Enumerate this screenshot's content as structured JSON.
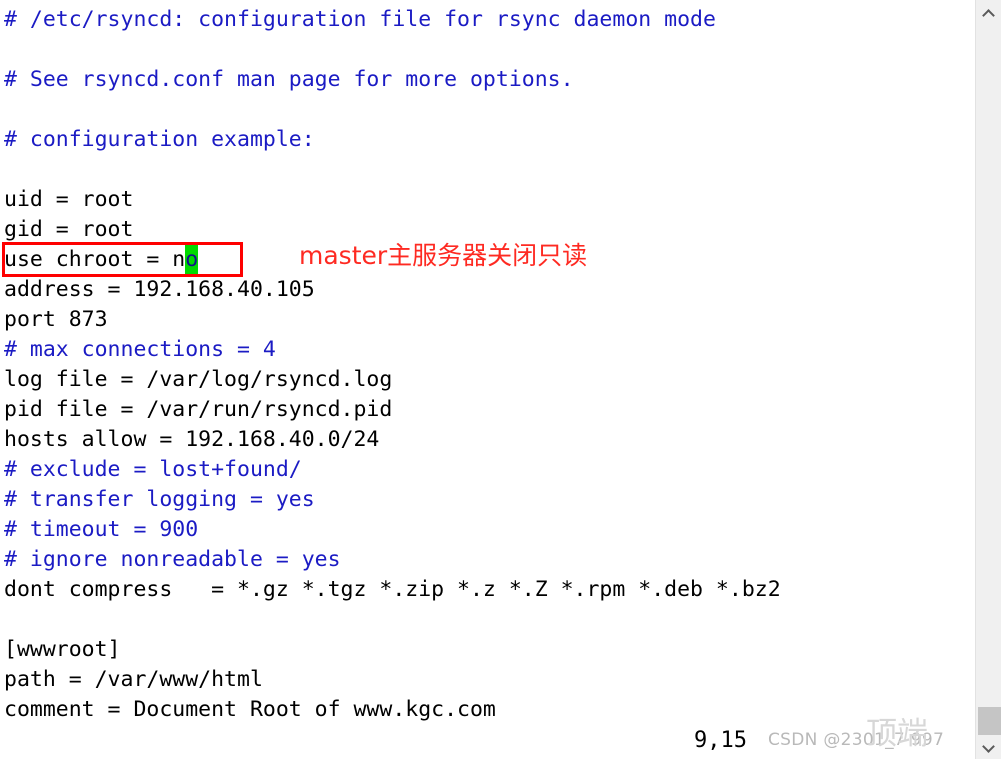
{
  "editor": {
    "file_type": "rsyncd-config",
    "lines": [
      {
        "text": "# /etc/rsyncd: configuration file for rsync daemon mode",
        "kind": "comment"
      },
      {
        "text": "",
        "kind": "blank"
      },
      {
        "text": "# See rsyncd.conf man page for more options.",
        "kind": "comment"
      },
      {
        "text": "",
        "kind": "blank"
      },
      {
        "text": "# configuration example:",
        "kind": "comment"
      },
      {
        "text": "",
        "kind": "blank"
      },
      {
        "text": "uid = root",
        "kind": "code"
      },
      {
        "text": "gid = root",
        "kind": "code"
      },
      {
        "text": "use chroot = no",
        "kind": "code",
        "cursor_col": 14
      },
      {
        "text": "address = 192.168.40.105",
        "kind": "code"
      },
      {
        "text": "port 873",
        "kind": "code"
      },
      {
        "text": "# max connections = 4",
        "kind": "comment"
      },
      {
        "text": "log file = /var/log/rsyncd.log",
        "kind": "code"
      },
      {
        "text": "pid file = /var/run/rsyncd.pid",
        "kind": "code"
      },
      {
        "text": "hosts allow = 192.168.40.0/24",
        "kind": "code"
      },
      {
        "text": "# exclude = lost+found/",
        "kind": "comment"
      },
      {
        "text": "# transfer logging = yes",
        "kind": "comment"
      },
      {
        "text": "# timeout = 900",
        "kind": "comment"
      },
      {
        "text": "# ignore nonreadable = yes",
        "kind": "comment"
      },
      {
        "text": "dont compress   = *.gz *.tgz *.zip *.z *.Z *.rpm *.deb *.bz2",
        "kind": "code"
      },
      {
        "text": "",
        "kind": "blank"
      },
      {
        "text": "[wwwroot]",
        "kind": "code"
      },
      {
        "text": "path = /var/www/html",
        "kind": "code"
      },
      {
        "text": "comment = Document Root of www.kgc.com",
        "kind": "code"
      }
    ],
    "colors": {
      "comment": "#1b1bc4",
      "code": "#000000",
      "background": "#ffffff",
      "cursor_background": "#00d900",
      "cursor_foreground": "#10108c"
    }
  },
  "annotation": {
    "box_label": "use chroot = no",
    "note_text": "master主服务器关闭只读",
    "color": "#fe0000",
    "note_color": "#fe2a22"
  },
  "status": {
    "cursor_position": "9,15"
  },
  "watermark": {
    "small_text": "CSDN @2301_7    997",
    "big_text": "顶端"
  },
  "scrollbar": {
    "up_arrow": "chevron-up",
    "down_arrow": "chevron-down",
    "orientation": "vertical"
  }
}
